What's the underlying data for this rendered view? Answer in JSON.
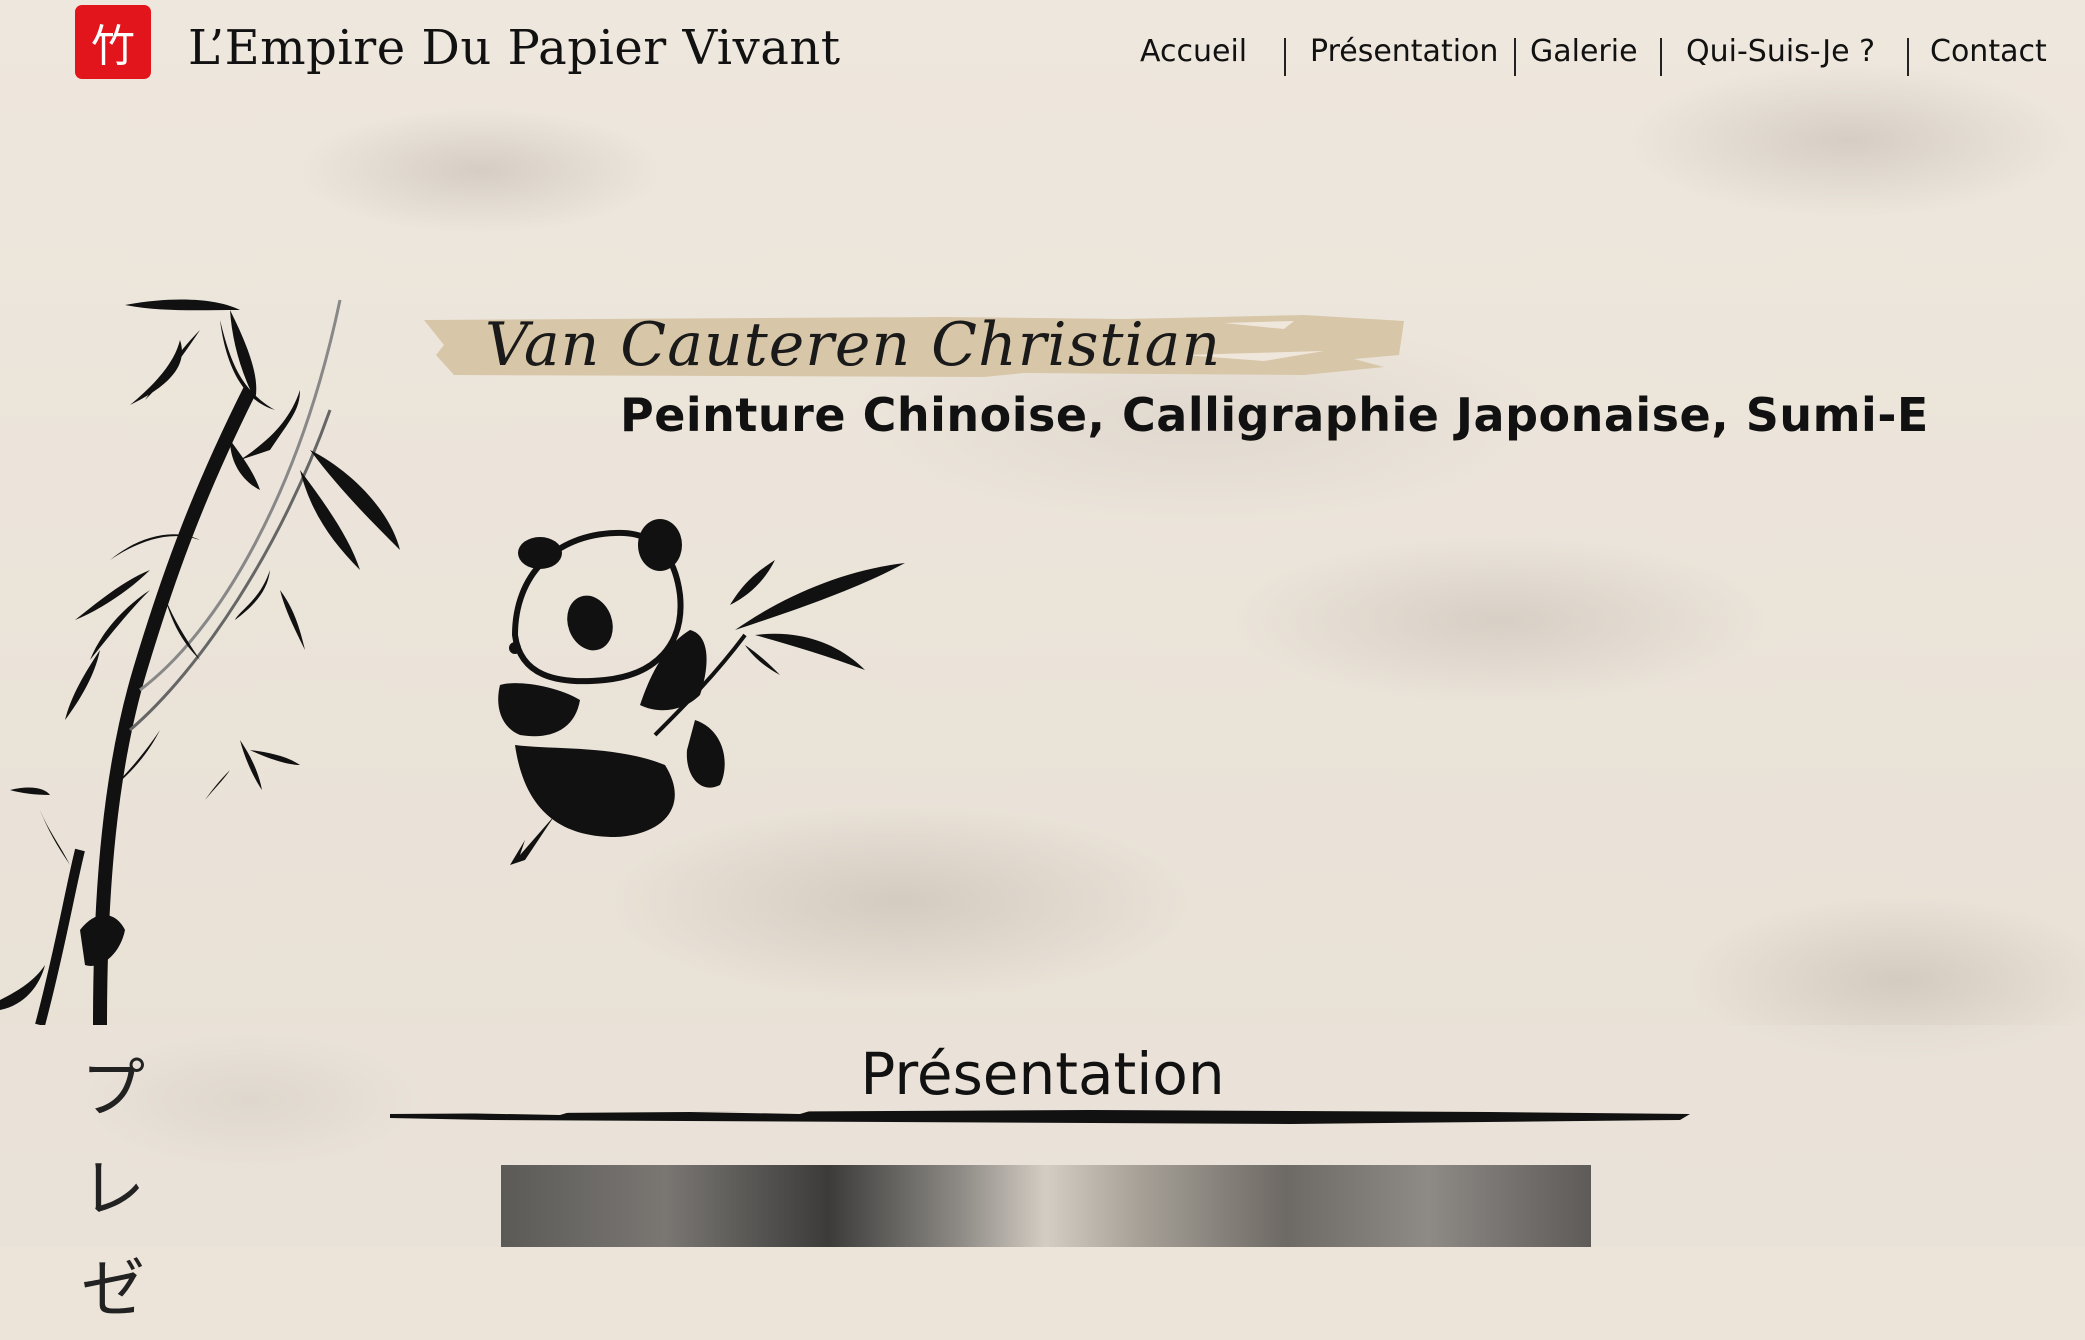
{
  "header": {
    "logo_glyph": "竹",
    "title": "L’Empire Du Papier Vivant"
  },
  "nav": {
    "items": [
      "Accueil",
      "Présentation",
      "Galerie",
      "Qui-Suis-Je ?",
      "Contact"
    ]
  },
  "hero": {
    "name": "Van Cauteren Christian",
    "subtitle": "Peinture Chinoise, Calligraphie Japonaise, Sumi-E"
  },
  "section": {
    "kana": [
      "プ",
      "レ",
      "ゼ"
    ],
    "title": "Présentation"
  },
  "colors": {
    "logo_red": "#e1151b",
    "banner_tan": "#d8c6a8",
    "ink": "#111111"
  }
}
